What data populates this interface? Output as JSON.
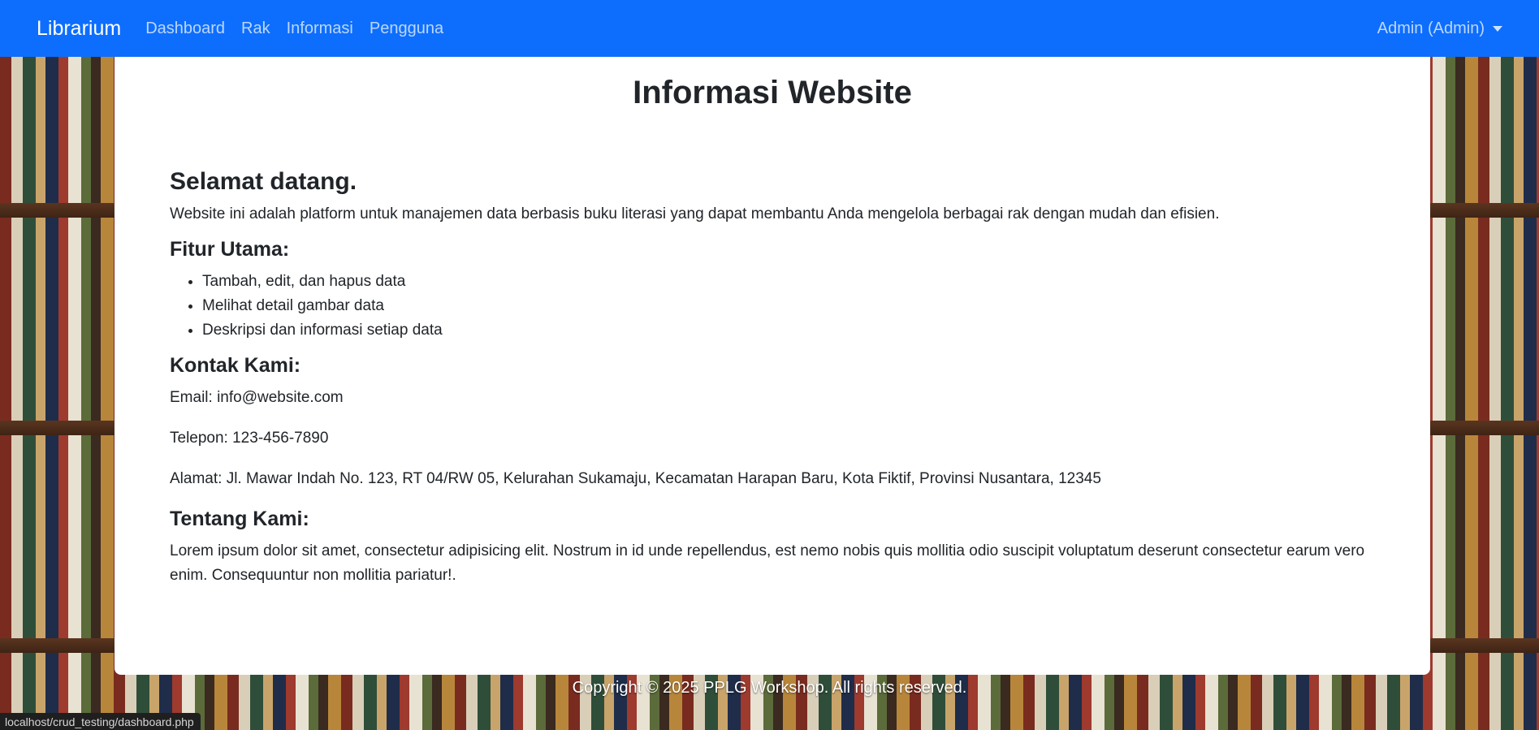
{
  "navbar": {
    "brand": "Librarium",
    "links": [
      "Dashboard",
      "Rak",
      "Informasi",
      "Pengguna"
    ],
    "user": "Admin (Admin)"
  },
  "main": {
    "title": "Informasi Website",
    "welcome_heading": "Selamat datang.",
    "welcome_text": "Website ini adalah platform untuk manajemen data berbasis buku literasi yang dapat membantu Anda mengelola berbagai rak dengan mudah dan efisien.",
    "features_heading": "Fitur Utama:",
    "features": [
      "Tambah, edit, dan hapus data",
      "Melihat detail gambar data",
      "Deskripsi dan informasi setiap data"
    ],
    "contact_heading": "Kontak Kami:",
    "email": "Email: info@website.com",
    "phone": "Telepon: 123-456-7890",
    "address": "Alamat: Jl. Mawar Indah No. 123, RT 04/RW 05, Kelurahan Sukamaju, Kecamatan Harapan Baru, Kota Fiktif, Provinsi Nusantara, 12345",
    "about_heading": "Tentang Kami:",
    "about_text": "Lorem ipsum dolor sit amet, consectetur adipisicing elit. Nostrum in id unde repellendus, est nemo nobis quis mollitia odio suscipit voluptatum deserunt consectetur earum vero enim. Consequuntur non mollitia pariatur!."
  },
  "footer": {
    "text": "Copyright © 2025 PPLG Workshop. All rights reserved."
  },
  "statusbar": {
    "url": "localhost/crud_testing/dashboard.php"
  },
  "colors": {
    "navbar": "#0d6efd",
    "card": "#ffffff",
    "text": "#212529"
  }
}
